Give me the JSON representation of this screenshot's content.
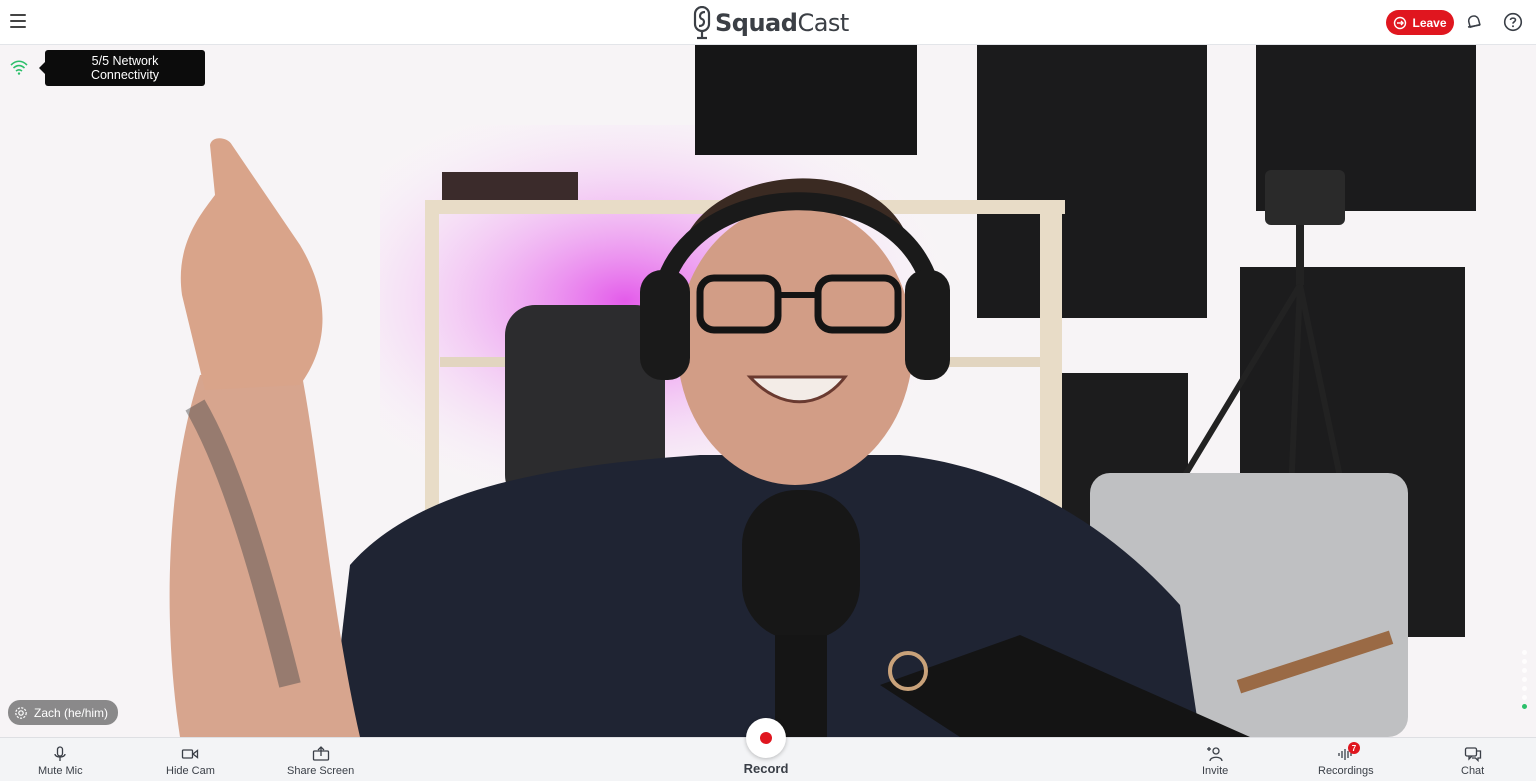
{
  "header": {
    "brand": {
      "prefix": "Squad",
      "suffix": "Cast"
    },
    "leave_label": "Leave",
    "icons": {
      "menu": "hamburger-menu-icon",
      "leave": "exit-icon",
      "notifications": "bell-icon",
      "help": "help-circle-icon"
    }
  },
  "network": {
    "icon": "wifi-icon",
    "tooltip_line1": "5/5 Network",
    "tooltip_line2": "Connectivity",
    "color": "#2bbf6a"
  },
  "participant": {
    "name": "Zach (he/him)",
    "icon": "gear-icon"
  },
  "toolbar": {
    "mute_mic": "Mute Mic",
    "hide_cam": "Hide Cam",
    "share_screen": "Share Screen",
    "record": "Record",
    "invite": "Invite",
    "recordings": "Recordings",
    "recordings_count": "7",
    "chat": "Chat"
  },
  "colors": {
    "accent": "#e0161f",
    "toolbar_bg": "#f3f4f6"
  }
}
